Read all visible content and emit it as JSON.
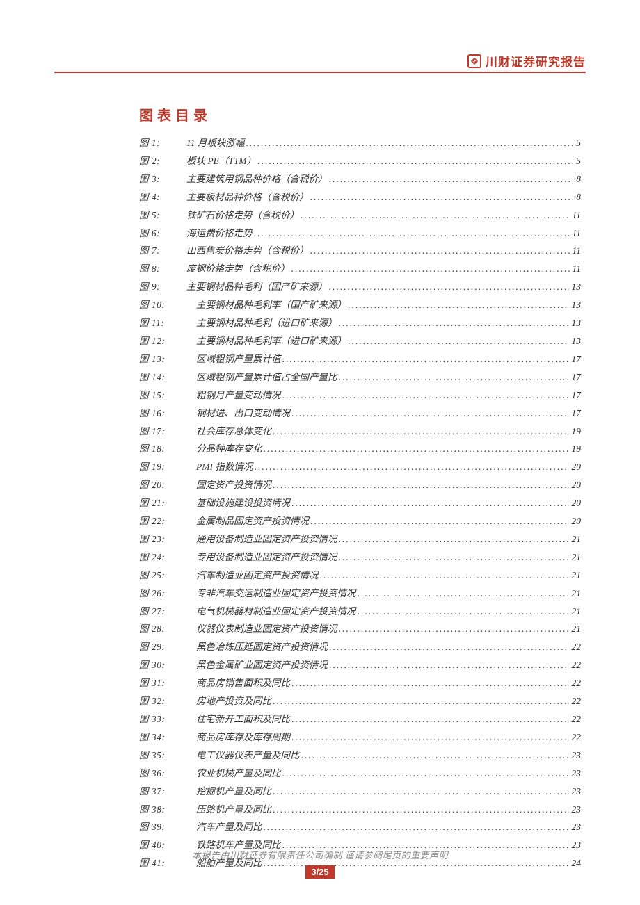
{
  "header": {
    "brand": "川财证券研究报告"
  },
  "toc": {
    "heading": "图表目录",
    "entries": [
      {
        "label": "图 1:",
        "title": "11 月板块涨幅",
        "page": "5",
        "indent": false
      },
      {
        "label": "图 2:",
        "title": "板块 PE（TTM）",
        "page": "5",
        "indent": false
      },
      {
        "label": "图 3:",
        "title": "主要建筑用钢品种价格（含税价）",
        "page": "8",
        "indent": false
      },
      {
        "label": "图 4:",
        "title": "主要板材品种价格（含税价）",
        "page": "8",
        "indent": false
      },
      {
        "label": "图 5:",
        "title": "铁矿石价格走势（含税价）",
        "page": "11",
        "indent": false
      },
      {
        "label": "图 6:",
        "title": "海运费价格走势",
        "page": "11",
        "indent": false
      },
      {
        "label": "图 7:",
        "title": "山西焦炭价格走势（含税价）",
        "page": "11",
        "indent": false
      },
      {
        "label": "图 8:",
        "title": "废钢价格走势（含税价）",
        "page": "11",
        "indent": false
      },
      {
        "label": "图 9:",
        "title": "主要钢材品种毛利（国产矿来源）",
        "page": "13",
        "indent": false
      },
      {
        "label": "图 10:",
        "title": "主要钢材品种毛利率（国产矿来源）",
        "page": "13",
        "indent": true
      },
      {
        "label": "图 11:",
        "title": "主要钢材品种毛利（进口矿来源）",
        "page": "13",
        "indent": true
      },
      {
        "label": "图 12:",
        "title": "主要钢材品种毛利率（进口矿来源）",
        "page": "13",
        "indent": true
      },
      {
        "label": "图 13:",
        "title": "区域粗钢产量累计值",
        "page": "17",
        "indent": true
      },
      {
        "label": "图 14:",
        "title": "区域粗钢产量累计值占全国产量比",
        "page": "17",
        "indent": true
      },
      {
        "label": "图 15:",
        "title": "粗钢月产量变动情况",
        "page": "17",
        "indent": true
      },
      {
        "label": "图 16:",
        "title": "钢材进、出口变动情况",
        "page": "17",
        "indent": true
      },
      {
        "label": "图 17:",
        "title": "社会库存总体变化",
        "page": "19",
        "indent": true
      },
      {
        "label": "图 18:",
        "title": "分品种库存变化",
        "page": "19",
        "indent": true
      },
      {
        "label": "图 19:",
        "title": "PMI 指数情况",
        "page": "20",
        "indent": true
      },
      {
        "label": "图 20:",
        "title": "固定资产投资情况",
        "page": "20",
        "indent": true
      },
      {
        "label": "图 21:",
        "title": "基础设施建设投资情况",
        "page": "20",
        "indent": true
      },
      {
        "label": "图 22:",
        "title": "金属制品固定资产投资情况",
        "page": "20",
        "indent": true
      },
      {
        "label": "图 23:",
        "title": "通用设备制造业固定资产投资情况",
        "page": "21",
        "indent": true
      },
      {
        "label": "图 24:",
        "title": "专用设备制造业固定资产投资情况",
        "page": "21",
        "indent": true
      },
      {
        "label": "图 25:",
        "title": "汽车制造业固定资产投资情况",
        "page": "21",
        "indent": true
      },
      {
        "label": "图 26:",
        "title": "专非汽车交运制造业固定资产投资情况",
        "page": "21",
        "indent": true
      },
      {
        "label": "图 27:",
        "title": "电气机械器材制造业固定资产投资情况",
        "page": "21",
        "indent": true
      },
      {
        "label": "图 28:",
        "title": "仪器仪表制造业固定资产投资情况",
        "page": "21",
        "indent": true
      },
      {
        "label": "图 29:",
        "title": "黑色冶炼压延固定资产投资情况",
        "page": "22",
        "indent": true
      },
      {
        "label": "图 30:",
        "title": "黑色金属矿业固定资产投资情况",
        "page": "22",
        "indent": true
      },
      {
        "label": "图 31:",
        "title": "商品房销售面积及同比",
        "page": "22",
        "indent": true
      },
      {
        "label": "图 32:",
        "title": "房地产投资及同比",
        "page": "22",
        "indent": true
      },
      {
        "label": "图 33:",
        "title": "住宅新开工面积及同比",
        "page": "22",
        "indent": true
      },
      {
        "label": "图 34:",
        "title": "商品房库存及库存周期",
        "page": "22",
        "indent": true
      },
      {
        "label": "图 35:",
        "title": "电工仪器仪表产量及同比",
        "page": "23",
        "indent": true
      },
      {
        "label": "图 36:",
        "title": "农业机械产量及同比",
        "page": "23",
        "indent": true
      },
      {
        "label": "图 37:",
        "title": "挖掘机产量及同比",
        "page": "23",
        "indent": true
      },
      {
        "label": "图 38:",
        "title": "压路机产量及同比",
        "page": "23",
        "indent": true
      },
      {
        "label": "图 39:",
        "title": "汽车产量及同比",
        "page": "23",
        "indent": true
      },
      {
        "label": "图 40:",
        "title": "铁路机车产量及同比",
        "page": "23",
        "indent": true
      },
      {
        "label": "图 41:",
        "title": "船舶产量及同比",
        "page": "24",
        "indent": true
      }
    ]
  },
  "footer": {
    "disclaimer": "本报告由川财证券有限责任公司编制 谨请参阅尾页的重要声明",
    "page": "3/25"
  }
}
